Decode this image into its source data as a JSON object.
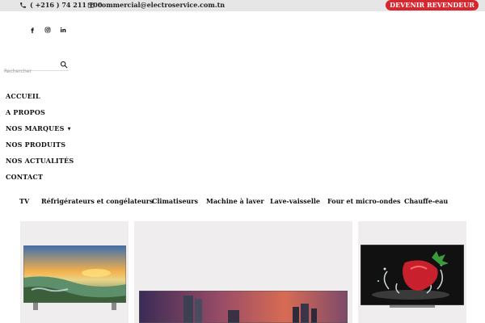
{
  "topbar": {
    "phone": "( +216 ) 74 211 100",
    "email": "commercial@electroservice.com.tn",
    "reseller_button": "DEVENIR REVENDEUR",
    "background": "#e6e6e6",
    "accent": "#d8262e"
  },
  "social": {
    "icons": [
      "facebook-icon",
      "instagram-icon",
      "linkedin-icon"
    ]
  },
  "search": {
    "placeholder": "Rechercher",
    "icon": "search-icon"
  },
  "nav": {
    "items": [
      {
        "label": "ACCUEIL"
      },
      {
        "label": "A PROPOS"
      },
      {
        "label": "NOS MARQUES",
        "has_dropdown": true
      },
      {
        "label": "NOS PRODUITS"
      },
      {
        "label": "NOS ACTUALITÉS"
      },
      {
        "label": "CONTACT"
      }
    ]
  },
  "categories": {
    "items": [
      {
        "label": "TV"
      },
      {
        "label": "Réfrigérateurs et congélateurs"
      },
      {
        "label": "Climatiseurs"
      },
      {
        "label": "Machine à laver"
      },
      {
        "label": "Lave-vaisselle"
      },
      {
        "label": "Four et micro-ondes"
      },
      {
        "label": "Chauffe-eau"
      }
    ]
  },
  "products": {
    "card_background": "#efeded",
    "images": [
      "tv-landscape-sunset-image",
      "tv-city-skyline-image",
      "tv-strawberry-splash-image"
    ]
  }
}
